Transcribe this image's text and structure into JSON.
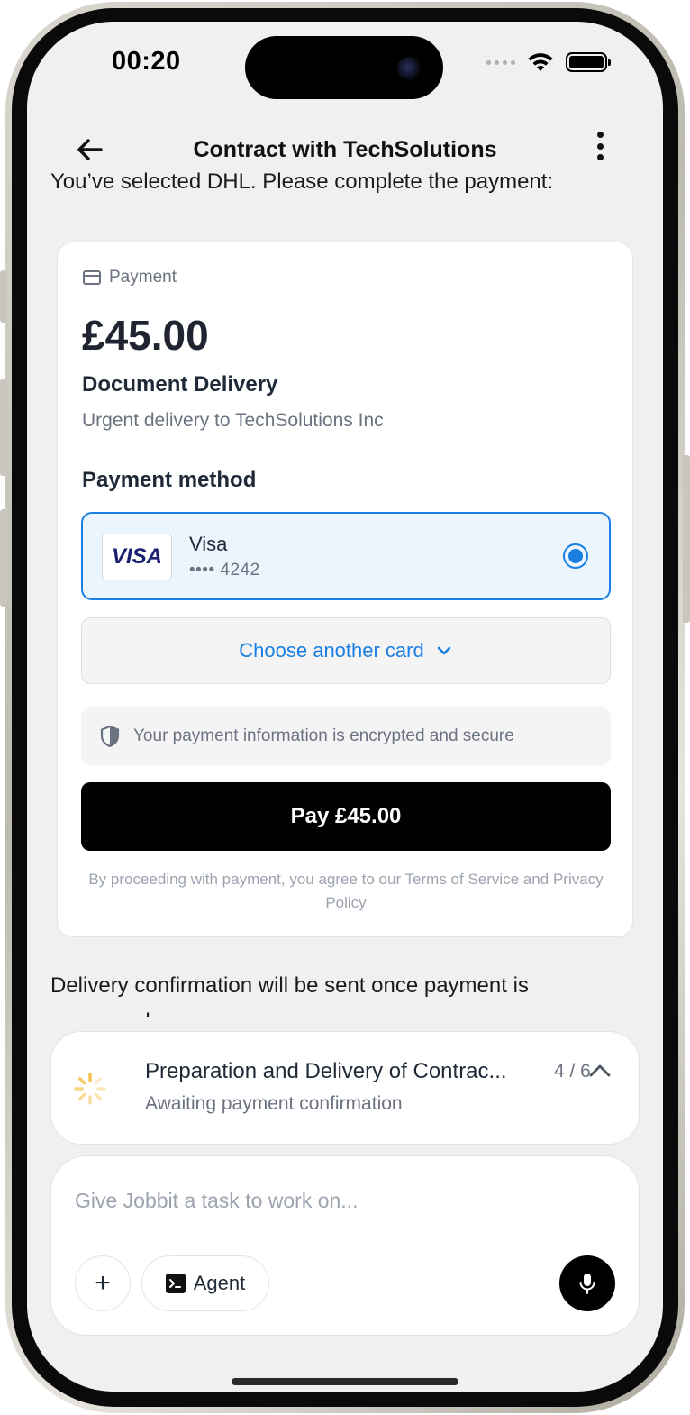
{
  "status_bar": {
    "time": "00:20"
  },
  "header": {
    "title": "Contract with TechSolutions"
  },
  "chat": {
    "message_top": "You’ve selected DHL. Please complete the payment:",
    "message_bottom": "Delivery confirmation will be sent once payment is processed"
  },
  "payment_card": {
    "label": "Payment",
    "amount": "£45.00",
    "description_title": "Document Delivery",
    "description_subtitle": "Urgent delivery to TechSolutions Inc",
    "method_title": "Payment method",
    "selected_card": {
      "brand_logo": "VISA",
      "name": "Visa",
      "number": "•••• 4242",
      "selected": true
    },
    "choose_another_label": "Choose another card",
    "secure_note": "Your payment information is encrypted and secure",
    "pay_button_label": "Pay £45.00",
    "terms_text": "By proceeding with payment, you agree to our Terms of Service and Privacy Policy"
  },
  "task_panel": {
    "title": "Preparation and Delivery of Contrac...",
    "progress": "4 / 6",
    "status": "Awaiting payment confirmation"
  },
  "composer": {
    "placeholder": "Give Jobbit a task to work on...",
    "agent_label": "Agent",
    "plus_label": "+"
  },
  "colors": {
    "accent": "#1a7fe0",
    "selected_bg": "#eaf5fd",
    "spinner": "#f5c04a"
  }
}
